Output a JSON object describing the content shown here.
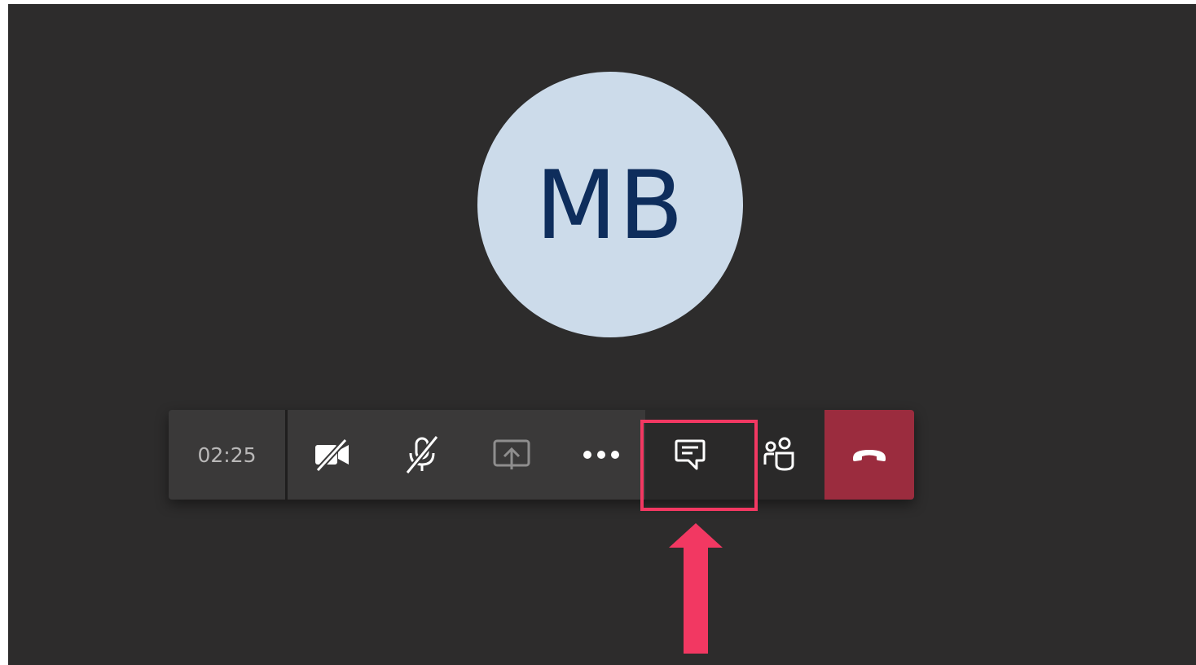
{
  "participant": {
    "initials": "MB",
    "avatar_bg": "#ccdbea",
    "initials_color": "#0e2d5c"
  },
  "call_controls": {
    "timer": "02:25",
    "buttons": [
      {
        "id": "camera",
        "icon": "video-off-icon",
        "state": "off"
      },
      {
        "id": "microphone",
        "icon": "mic-off-icon",
        "state": "muted"
      },
      {
        "id": "share",
        "icon": "share-screen-icon",
        "state": "disabled"
      },
      {
        "id": "more",
        "icon": "more-actions-icon"
      },
      {
        "id": "chat",
        "icon": "chat-icon",
        "highlighted": true
      },
      {
        "id": "participants",
        "icon": "participants-icon"
      },
      {
        "id": "hang-up",
        "icon": "hang-up-icon",
        "color": "#9b2c3e"
      }
    ]
  },
  "annotation": {
    "highlight_color": "#f23862",
    "target": "chat",
    "arrow_direction": "up"
  },
  "colors": {
    "stage_bg": "#2d2c2c",
    "toolbar_bg": "#3a3939",
    "toolbar_dark_bg": "#2a2929",
    "hangup_bg": "#9b2c3e"
  }
}
